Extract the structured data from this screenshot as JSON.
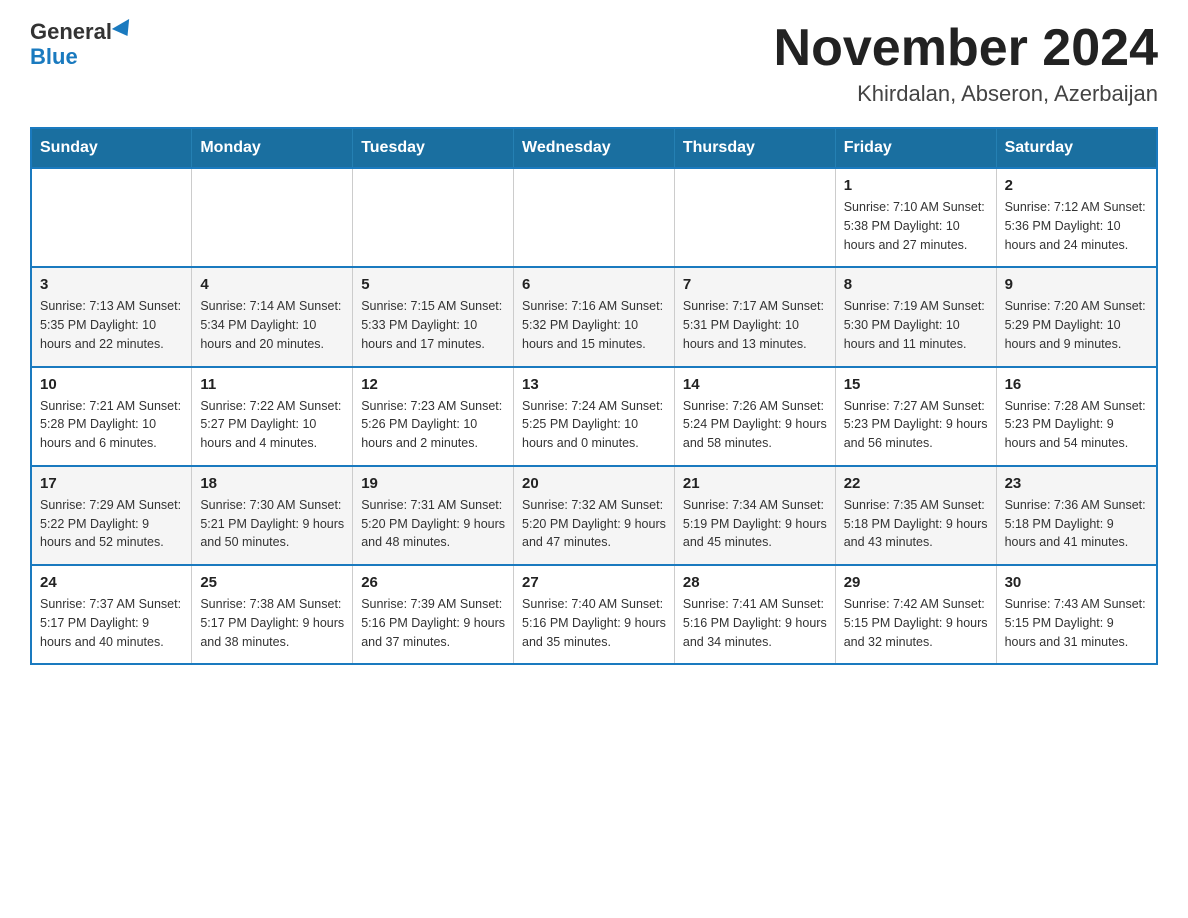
{
  "header": {
    "logo_general": "General",
    "logo_blue": "Blue",
    "main_title": "November 2024",
    "subtitle": "Khirdalan, Abseron, Azerbaijan"
  },
  "calendar": {
    "days_of_week": [
      "Sunday",
      "Monday",
      "Tuesday",
      "Wednesday",
      "Thursday",
      "Friday",
      "Saturday"
    ],
    "weeks": [
      {
        "row_class": "odd-row",
        "days": [
          {
            "number": "",
            "info": ""
          },
          {
            "number": "",
            "info": ""
          },
          {
            "number": "",
            "info": ""
          },
          {
            "number": "",
            "info": ""
          },
          {
            "number": "",
            "info": ""
          },
          {
            "number": "1",
            "info": "Sunrise: 7:10 AM\nSunset: 5:38 PM\nDaylight: 10 hours and 27 minutes."
          },
          {
            "number": "2",
            "info": "Sunrise: 7:12 AM\nSunset: 5:36 PM\nDaylight: 10 hours and 24 minutes."
          }
        ]
      },
      {
        "row_class": "even-row",
        "days": [
          {
            "number": "3",
            "info": "Sunrise: 7:13 AM\nSunset: 5:35 PM\nDaylight: 10 hours and 22 minutes."
          },
          {
            "number": "4",
            "info": "Sunrise: 7:14 AM\nSunset: 5:34 PM\nDaylight: 10 hours and 20 minutes."
          },
          {
            "number": "5",
            "info": "Sunrise: 7:15 AM\nSunset: 5:33 PM\nDaylight: 10 hours and 17 minutes."
          },
          {
            "number": "6",
            "info": "Sunrise: 7:16 AM\nSunset: 5:32 PM\nDaylight: 10 hours and 15 minutes."
          },
          {
            "number": "7",
            "info": "Sunrise: 7:17 AM\nSunset: 5:31 PM\nDaylight: 10 hours and 13 minutes."
          },
          {
            "number": "8",
            "info": "Sunrise: 7:19 AM\nSunset: 5:30 PM\nDaylight: 10 hours and 11 minutes."
          },
          {
            "number": "9",
            "info": "Sunrise: 7:20 AM\nSunset: 5:29 PM\nDaylight: 10 hours and 9 minutes."
          }
        ]
      },
      {
        "row_class": "odd-row",
        "days": [
          {
            "number": "10",
            "info": "Sunrise: 7:21 AM\nSunset: 5:28 PM\nDaylight: 10 hours and 6 minutes."
          },
          {
            "number": "11",
            "info": "Sunrise: 7:22 AM\nSunset: 5:27 PM\nDaylight: 10 hours and 4 minutes."
          },
          {
            "number": "12",
            "info": "Sunrise: 7:23 AM\nSunset: 5:26 PM\nDaylight: 10 hours and 2 minutes."
          },
          {
            "number": "13",
            "info": "Sunrise: 7:24 AM\nSunset: 5:25 PM\nDaylight: 10 hours and 0 minutes."
          },
          {
            "number": "14",
            "info": "Sunrise: 7:26 AM\nSunset: 5:24 PM\nDaylight: 9 hours and 58 minutes."
          },
          {
            "number": "15",
            "info": "Sunrise: 7:27 AM\nSunset: 5:23 PM\nDaylight: 9 hours and 56 minutes."
          },
          {
            "number": "16",
            "info": "Sunrise: 7:28 AM\nSunset: 5:23 PM\nDaylight: 9 hours and 54 minutes."
          }
        ]
      },
      {
        "row_class": "even-row",
        "days": [
          {
            "number": "17",
            "info": "Sunrise: 7:29 AM\nSunset: 5:22 PM\nDaylight: 9 hours and 52 minutes."
          },
          {
            "number": "18",
            "info": "Sunrise: 7:30 AM\nSunset: 5:21 PM\nDaylight: 9 hours and 50 minutes."
          },
          {
            "number": "19",
            "info": "Sunrise: 7:31 AM\nSunset: 5:20 PM\nDaylight: 9 hours and 48 minutes."
          },
          {
            "number": "20",
            "info": "Sunrise: 7:32 AM\nSunset: 5:20 PM\nDaylight: 9 hours and 47 minutes."
          },
          {
            "number": "21",
            "info": "Sunrise: 7:34 AM\nSunset: 5:19 PM\nDaylight: 9 hours and 45 minutes."
          },
          {
            "number": "22",
            "info": "Sunrise: 7:35 AM\nSunset: 5:18 PM\nDaylight: 9 hours and 43 minutes."
          },
          {
            "number": "23",
            "info": "Sunrise: 7:36 AM\nSunset: 5:18 PM\nDaylight: 9 hours and 41 minutes."
          }
        ]
      },
      {
        "row_class": "odd-row",
        "days": [
          {
            "number": "24",
            "info": "Sunrise: 7:37 AM\nSunset: 5:17 PM\nDaylight: 9 hours and 40 minutes."
          },
          {
            "number": "25",
            "info": "Sunrise: 7:38 AM\nSunset: 5:17 PM\nDaylight: 9 hours and 38 minutes."
          },
          {
            "number": "26",
            "info": "Sunrise: 7:39 AM\nSunset: 5:16 PM\nDaylight: 9 hours and 37 minutes."
          },
          {
            "number": "27",
            "info": "Sunrise: 7:40 AM\nSunset: 5:16 PM\nDaylight: 9 hours and 35 minutes."
          },
          {
            "number": "28",
            "info": "Sunrise: 7:41 AM\nSunset: 5:16 PM\nDaylight: 9 hours and 34 minutes."
          },
          {
            "number": "29",
            "info": "Sunrise: 7:42 AM\nSunset: 5:15 PM\nDaylight: 9 hours and 32 minutes."
          },
          {
            "number": "30",
            "info": "Sunrise: 7:43 AM\nSunset: 5:15 PM\nDaylight: 9 hours and 31 minutes."
          }
        ]
      }
    ]
  }
}
